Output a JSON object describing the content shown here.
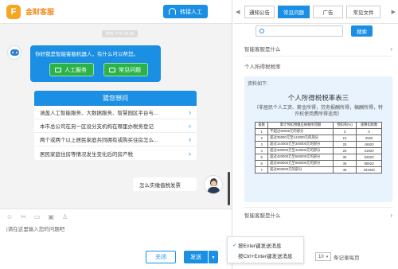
{
  "header": {
    "logo_letter": "F",
    "brand": "金财客服",
    "transfer_label": "转接人工"
  },
  "chat": {
    "timestamp": "昨天 下午 03:55",
    "welcome_text": "你好我是智能客服机器人，有什么可以帮您。",
    "btn_manual": "人工服务",
    "btn_faq": "常见问题",
    "guess_title": "猜您想问",
    "guess_items": [
      "涵盖人工智能服务、大数据服务、智慧园区平台与...",
      "本市总公司在另一区设分支机构在哪里办税务登记",
      "两个或两个以上居民家庭共同拥有或购买住房怎么...",
      "居民家庭住房等情况发生变化后的房产税"
    ],
    "user_message": "怎么实缴值税发票"
  },
  "input": {
    "placeholder": "|请在这里输入您的问题吧",
    "close_label": "关闭",
    "send_label": "发送"
  },
  "right": {
    "tabs": [
      "通知公告",
      "常见问题",
      "广告",
      "常见文件"
    ],
    "active_tab": "常见问题",
    "search_label": "搜索",
    "faq1": "智能客服是什么",
    "faq2": "个人所得税税率",
    "answer_label": "资料如下:",
    "answer_title": "个人所得税税率表三",
    "answer_sub": "（非居民个人工资、薪金所得，劳务报酬所得，稿酬所得，特许权使用费所得适用）",
    "table_headers": [
      "级数",
      "累计预扣预缴应纳税所得额",
      "预扣率(%)",
      "速算扣除数"
    ],
    "table_rows": [
      [
        "1",
        "不超过36000元的部分",
        "3",
        "0"
      ],
      [
        "2",
        "超过36000元至144000元的部分",
        "10",
        "2520"
      ],
      [
        "3",
        "超过144000元至300000元的部分",
        "20",
        "16920"
      ],
      [
        "4",
        "超过300000元至420000元的部分",
        "25",
        "31920"
      ],
      [
        "5",
        "超过420000元至660000元的部分",
        "30",
        "52920"
      ],
      [
        "6",
        "超过660000元至960000元的部分",
        "35",
        "85920"
      ],
      [
        "7",
        "超过960000元的部分",
        "45",
        "181920"
      ]
    ],
    "faq3": "智能客服是什么"
  },
  "context_menu": {
    "opt1": "按Enter键发送消息",
    "opt2": "按Ctrl+Enter键发送消息"
  },
  "pager": {
    "page_size": "10",
    "suffix": "条记录每页"
  },
  "colors": {
    "accent": "#1a8fe3",
    "brand": "#f08a1c",
    "green": "#2bb34a"
  }
}
